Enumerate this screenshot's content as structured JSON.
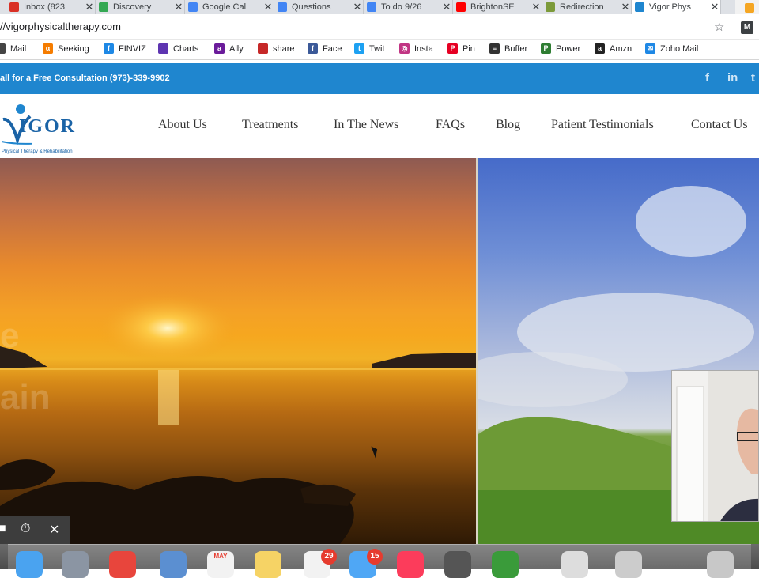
{
  "tabs": [
    {
      "label": "Inbox (823",
      "color": "#d93025"
    },
    {
      "label": "Discovery",
      "color": "#34a853"
    },
    {
      "label": "Google Cal",
      "color": "#4285f4"
    },
    {
      "label": "Questions",
      "color": "#4285f4"
    },
    {
      "label": "To do 9/26",
      "color": "#4285f4"
    },
    {
      "label": "BrightonSE",
      "color": "#ff0000"
    },
    {
      "label": "Redirection",
      "color": "#7c9a3a"
    },
    {
      "label": "Vigor Phys",
      "color": "#1f86cf"
    }
  ],
  "tab_close_glyph": "✕",
  "address": {
    "url": "//vigorphysicaltherapy.com",
    "star_glyph": "☆",
    "ext_label": "M"
  },
  "bookmarks": [
    {
      "label": "Mail",
      "icon": "mail-icon",
      "glyph": "",
      "color": "#444"
    },
    {
      "label": "Seeking",
      "icon": "seeking-icon",
      "glyph": "α",
      "color": "#f57c00"
    },
    {
      "label": "FINVIZ",
      "icon": "finviz-icon",
      "glyph": "f",
      "color": "#1e88e5"
    },
    {
      "label": "Charts",
      "icon": "charts-icon",
      "glyph": "",
      "color": "#5e35b1"
    },
    {
      "label": "Ally",
      "icon": "ally-icon",
      "glyph": "a",
      "color": "#6a1b9a"
    },
    {
      "label": "share",
      "icon": "share-icon",
      "glyph": "",
      "color": "#c62828"
    },
    {
      "label": "Face",
      "icon": "facebook-icon",
      "glyph": "f",
      "color": "#3b5998"
    },
    {
      "label": "Twit",
      "icon": "twitter-icon",
      "glyph": "t",
      "color": "#1da1f2"
    },
    {
      "label": "Insta",
      "icon": "instagram-icon",
      "glyph": "◎",
      "color": "#c13584"
    },
    {
      "label": "Pin",
      "icon": "pinterest-icon",
      "glyph": "P",
      "color": "#e60023"
    },
    {
      "label": "Buffer",
      "icon": "buffer-icon",
      "glyph": "≡",
      "color": "#333"
    },
    {
      "label": "Power",
      "icon": "power-icon",
      "glyph": "P",
      "color": "#2e7d32"
    },
    {
      "label": "Amzn",
      "icon": "amazon-icon",
      "glyph": "a",
      "color": "#222"
    },
    {
      "label": "Zoho Mail",
      "icon": "zoho-mail-icon",
      "glyph": "✉",
      "color": "#1e88e5"
    }
  ],
  "site": {
    "consultation": "all for a Free Consultation (973)-339-9902",
    "social": [
      {
        "name": "facebook-icon",
        "glyph": "f"
      },
      {
        "name": "linkedin-icon",
        "glyph": "in"
      }
    ],
    "logo": {
      "brand": "IGOR",
      "tagline": "Physical Therapy & Rehabilitation"
    },
    "nav": [
      "About Us",
      "Treatments",
      "In The News",
      "FAQs",
      "Blog",
      "Patient Testimonials",
      "Contact Us"
    ],
    "hero_overlay": [
      "e",
      "ain"
    ]
  },
  "recorder": {
    "record_glyph": "■",
    "timer_glyph": "⏱",
    "close_glyph": "✕"
  },
  "dock": [
    {
      "name": "finder-icon",
      "color": "#4aa3f0"
    },
    {
      "name": "launchpad-icon",
      "color": "#8b95a3"
    },
    {
      "name": "chrome-icon",
      "color": "#e8453c"
    },
    {
      "name": "mail-stamp-icon",
      "color": "#5b8fd1"
    },
    {
      "name": "calendar-icon",
      "color": "#f2f2f2"
    },
    {
      "name": "notes-icon",
      "color": "#f6d365"
    },
    {
      "name": "reminders-icon",
      "color": "#f2f2f2",
      "badge": "29"
    },
    {
      "name": "messages-icon",
      "color": "#4fa7f5",
      "badge": "15"
    },
    {
      "name": "music-icon",
      "color": "#fc3c5b"
    },
    {
      "name": "calculator-icon",
      "color": "#555"
    },
    {
      "name": "photos-app-icon",
      "color": "#3a9b3a"
    },
    {
      "name": "printer-icon",
      "color": "#ddd"
    },
    {
      "name": "window-icon",
      "color": "#ccc"
    },
    {
      "name": "trash-icon",
      "color": "#c8c8c8"
    }
  ],
  "dock_calendar_month": "MAY"
}
